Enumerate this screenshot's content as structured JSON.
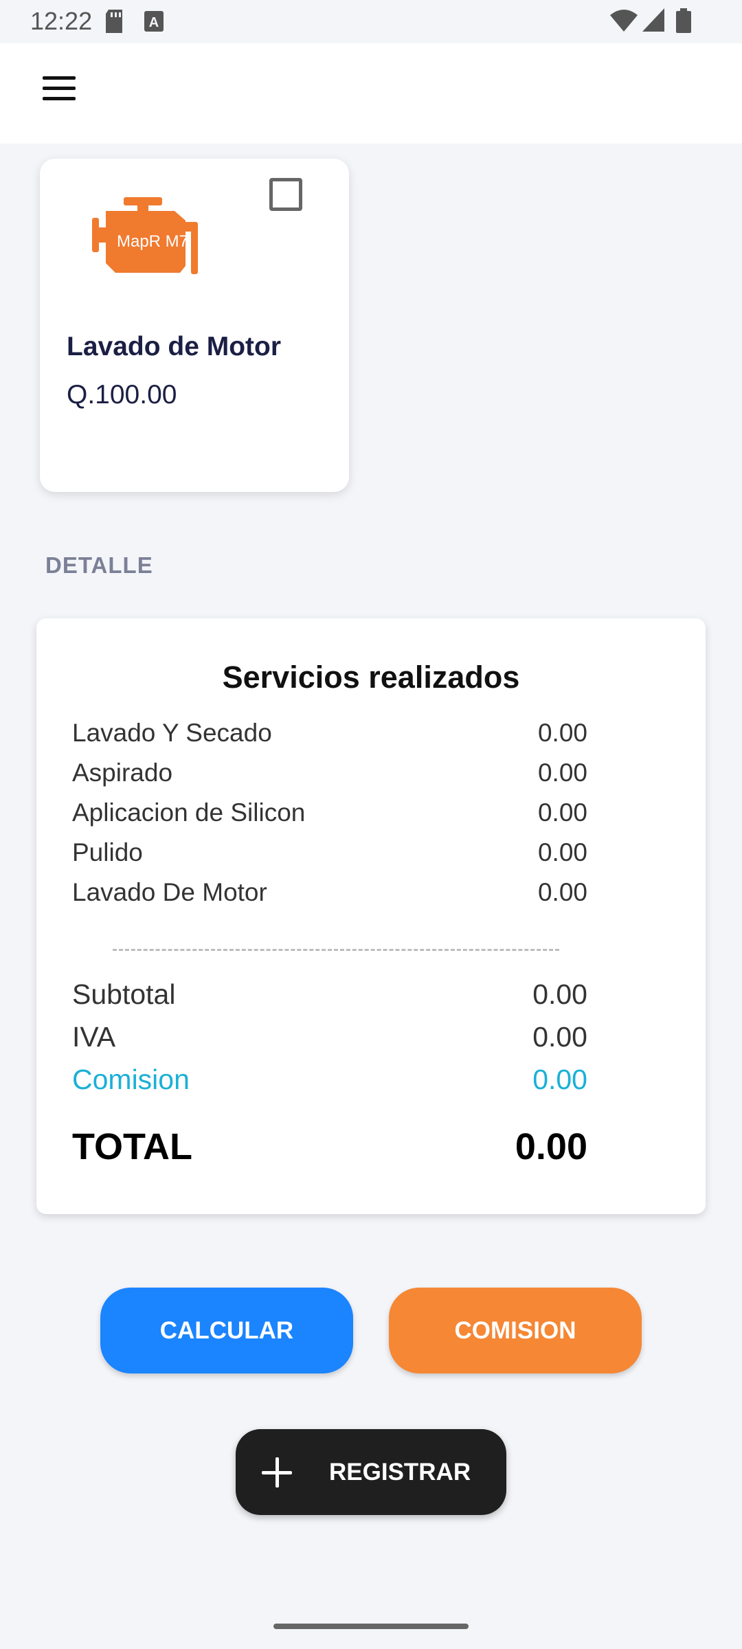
{
  "status_bar": {
    "time": "12:22",
    "icons": [
      "sd-card-icon",
      "text-a-icon",
      "wifi-icon",
      "signal-icon",
      "battery-icon"
    ]
  },
  "app_bar": {
    "menu_icon": "menu-icon"
  },
  "service_card": {
    "name": "Lavado de Motor",
    "price": "Q.100.00",
    "logo_text": "MapR M7",
    "checked": false,
    "icon_color": "#f07a2e"
  },
  "section": {
    "label": "DETALLE"
  },
  "receipt": {
    "title": "Servicios realizados",
    "items": [
      {
        "label": "Lavado Y Secado",
        "value": "0.00"
      },
      {
        "label": "Aspirado",
        "value": "0.00"
      },
      {
        "label": "Aplicacion de Silicon",
        "value": "0.00"
      },
      {
        "label": "Pulido",
        "value": "0.00"
      },
      {
        "label": "Lavado De Motor",
        "value": "0.00"
      }
    ],
    "subtotal": {
      "label": "Subtotal",
      "value": "0.00"
    },
    "iva": {
      "label": "IVA",
      "value": "0.00"
    },
    "comision": {
      "label": "Comision",
      "value": "0.00",
      "color": "#1ab0d6"
    },
    "total": {
      "label": "TOTAL",
      "value": "0.00"
    }
  },
  "buttons": {
    "calcular": {
      "label": "CALCULAR",
      "color": "#1b84ff"
    },
    "comision": {
      "label": "COMISION",
      "color": "#f58735"
    },
    "registrar": {
      "label": "REGISTRAR",
      "icon": "plus-icon"
    }
  }
}
